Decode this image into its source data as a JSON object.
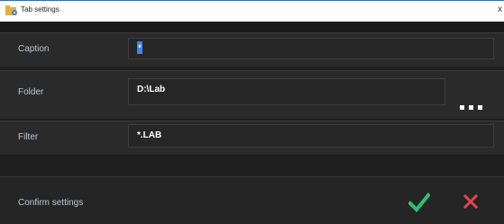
{
  "window": {
    "title": "Tab settings",
    "close_glyph": "x",
    "app_icon": "folder-settings-icon"
  },
  "fields": {
    "caption": {
      "label": "Caption",
      "value": "*"
    },
    "folder": {
      "label": "Folder",
      "value": "D:\\Lab",
      "browse_icon": "ellipsis-icon"
    },
    "filter": {
      "label": "Filter",
      "value": "*.LAB"
    }
  },
  "footer": {
    "confirm_label": "Confirm settings",
    "confirm_icon": "checkmark-icon",
    "cancel_icon": "cross-icon"
  },
  "colors": {
    "background": "#1e1e1e",
    "row_background": "#2a2a2a",
    "label_text": "#bfc6d4",
    "selection": "#3a86ff",
    "confirm_green": "#2fbf71",
    "cancel_red": "#e0454b"
  }
}
